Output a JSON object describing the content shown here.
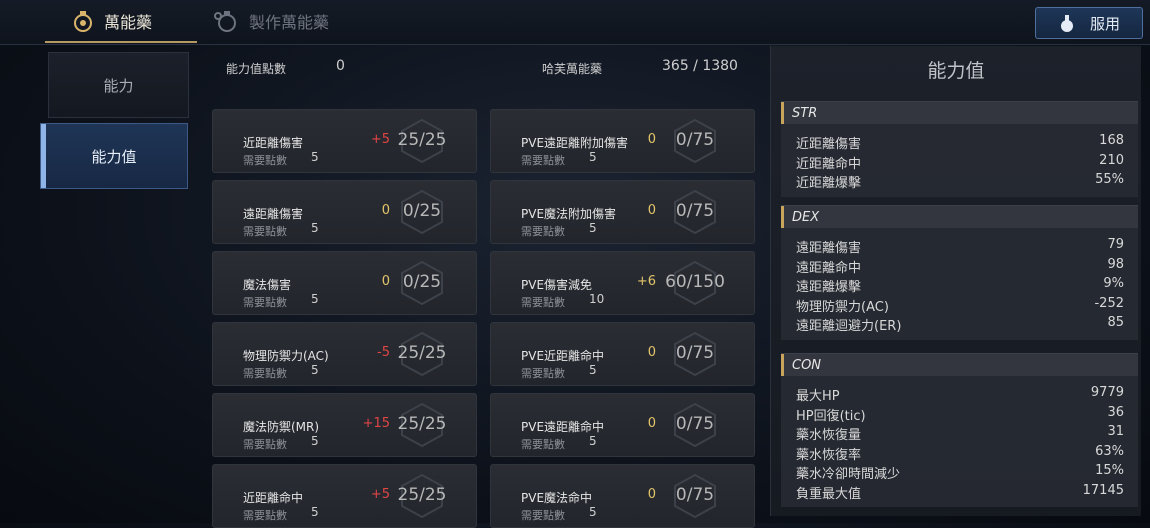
{
  "tabs": {
    "active": "萬能藥",
    "inactive": "製作萬能藥"
  },
  "use_button": "服用",
  "sidebar": [
    {
      "label": "能力"
    },
    {
      "label": "能力值"
    }
  ],
  "header": {
    "points_label": "能力值點數",
    "points_value": "0",
    "elixir_label": "哈芙萬能藥",
    "elixir_value": "365 / 1380"
  },
  "req_label": "需要點數",
  "cards_left": [
    {
      "name": "近距離傷害",
      "delta": "+5",
      "count": "25/25",
      "req": "5"
    },
    {
      "name": "遠距離傷害",
      "delta": "0",
      "count": "0/25",
      "req": "5"
    },
    {
      "name": "魔法傷害",
      "delta": "0",
      "count": "0/25",
      "req": "5"
    },
    {
      "name": "物理防禦力(AC)",
      "delta": "-5",
      "count": "25/25",
      "req": "5"
    },
    {
      "name": "魔法防禦(MR)",
      "delta": "+15",
      "count": "25/25",
      "req": "5"
    },
    {
      "name": "近距離命中",
      "delta": "+5",
      "count": "25/25",
      "req": "5"
    }
  ],
  "cards_right": [
    {
      "name": "PVE遠距離附加傷害",
      "delta": "0",
      "count": "0/75",
      "req": "5"
    },
    {
      "name": "PVE魔法附加傷害",
      "delta": "0",
      "count": "0/75",
      "req": "5"
    },
    {
      "name": "PVE傷害減免",
      "delta": "+6",
      "count": "60/150",
      "req": "10"
    },
    {
      "name": "PVE近距離命中",
      "delta": "0",
      "count": "0/75",
      "req": "5"
    },
    {
      "name": "PVE遠距離命中",
      "delta": "0",
      "count": "0/75",
      "req": "5"
    },
    {
      "name": "PVE魔法命中",
      "delta": "0",
      "count": "0/75",
      "req": "5"
    }
  ],
  "stats_panel": {
    "title": "能力值",
    "sections": [
      {
        "name": "STR",
        "rows": [
          [
            "近距離傷害",
            "168"
          ],
          [
            "近距離命中",
            "210"
          ],
          [
            "近距離爆擊",
            "55%"
          ]
        ]
      },
      {
        "name": "DEX",
        "rows": [
          [
            "遠距離傷害",
            "79"
          ],
          [
            "遠距離命中",
            "98"
          ],
          [
            "遠距離爆擊",
            "9%"
          ],
          [
            "物理防禦力(AC)",
            "-252"
          ],
          [
            "遠距離迴避力(ER)",
            "85"
          ]
        ]
      },
      {
        "name": "CON",
        "rows": [
          [
            "最大HP",
            "9779"
          ],
          [
            "HP回復(tic)",
            "36"
          ],
          [
            "藥水恢復量",
            "31"
          ],
          [
            "藥水恢復率",
            "63%"
          ],
          [
            "藥水冷卻時間減少",
            "15%"
          ],
          [
            "負重最大值",
            "17145"
          ]
        ]
      }
    ]
  }
}
